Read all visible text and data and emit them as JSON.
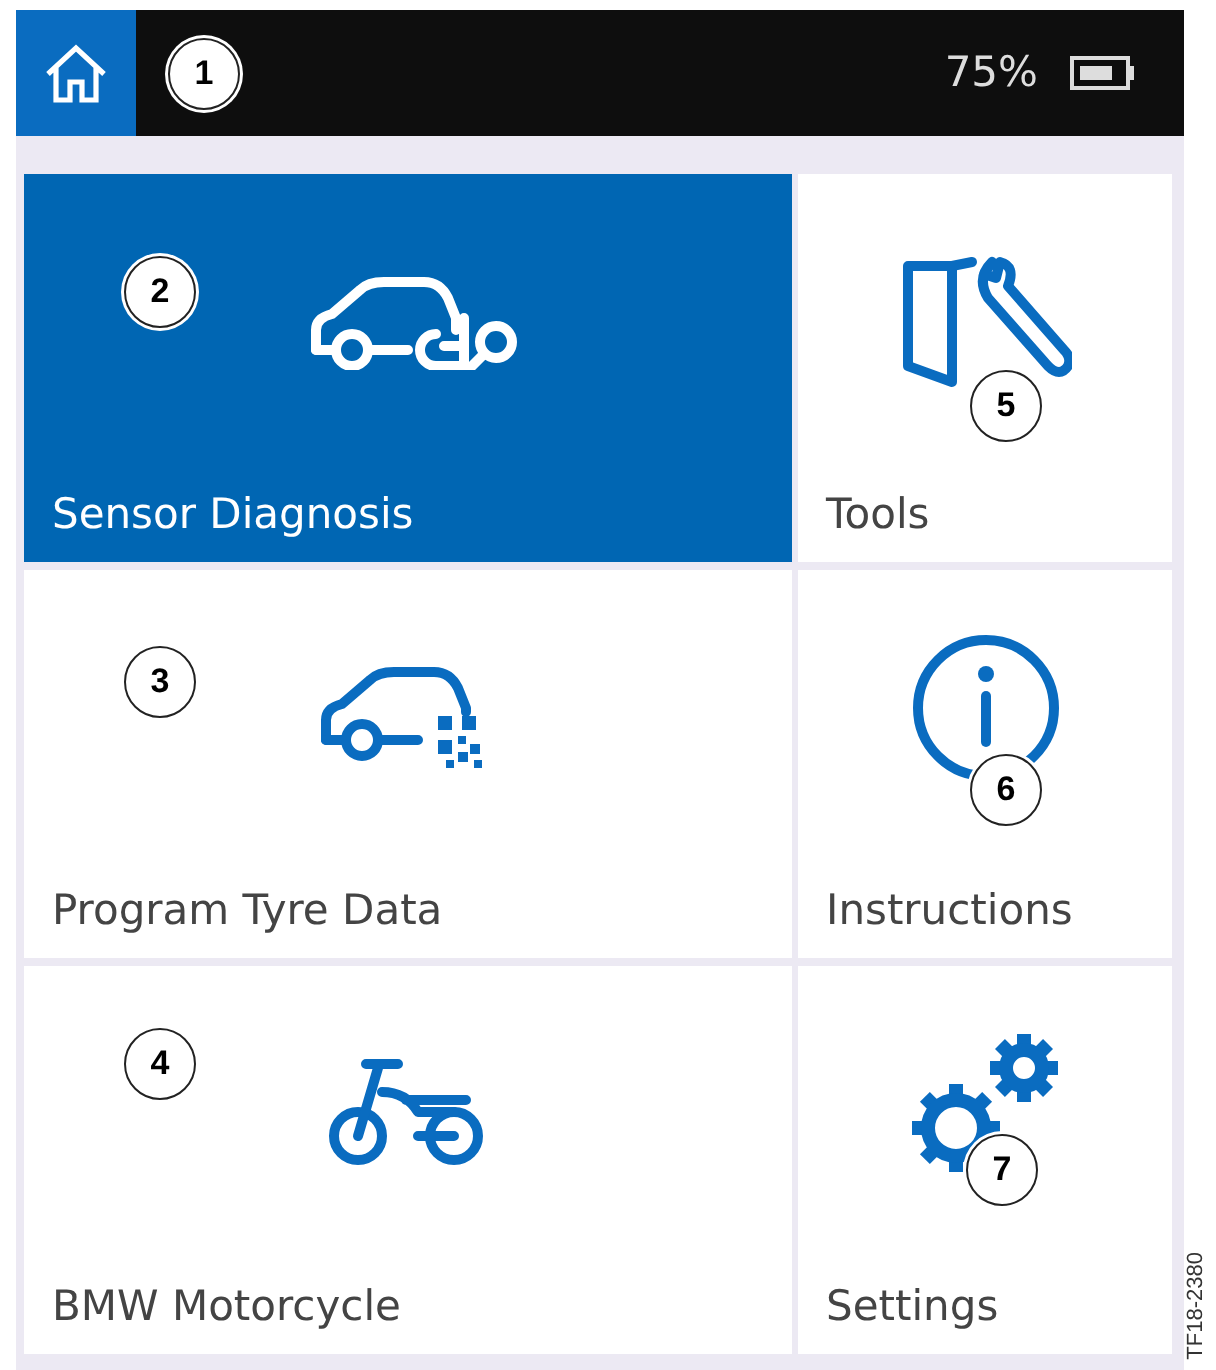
{
  "status_bar": {
    "home_callout": "1",
    "battery": "75%"
  },
  "tiles": [
    {
      "kind": "car-search",
      "label": "Sensor Diagnosis",
      "selected": true,
      "callout": "2"
    },
    {
      "kind": "tools",
      "label": "Tools",
      "selected": false,
      "callout": "5"
    },
    {
      "kind": "car-code",
      "label": "Program Tyre Data",
      "selected": false,
      "callout": "3"
    },
    {
      "kind": "info",
      "label": "Instructions",
      "selected": false,
      "callout": "6"
    },
    {
      "kind": "motorcycle",
      "label": "BMW Motorcycle",
      "selected": false,
      "callout": "4"
    },
    {
      "kind": "gears",
      "label": "Settings",
      "selected": false,
      "callout": "7"
    }
  ],
  "figure_id": "TF18-2380"
}
